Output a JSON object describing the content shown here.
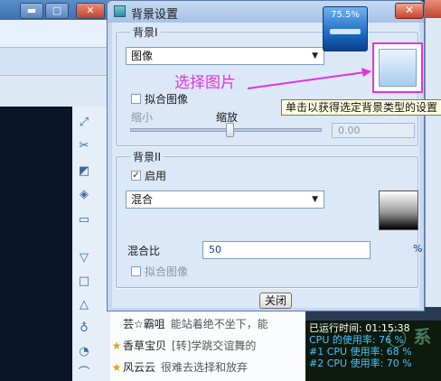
{
  "dialog": {
    "title": "背景设置",
    "close_glyph": "✕",
    "group1": {
      "title": "背景I",
      "type_select": "图像",
      "fit_image_label": "拟合图像",
      "scale_small_label": "缩小",
      "scale_label": "缩放",
      "scale_value": "0.00"
    },
    "group2": {
      "title": "背景II",
      "enable_label": "启用",
      "enable_checked": "✓",
      "type_select": "混合",
      "ratio_label": "混合比",
      "ratio_value": "50",
      "ratio_unit": "%",
      "fit_image_label": "拟合图像"
    },
    "close_button": "关闭"
  },
  "tooltip": "单击以获得选定背景类型的设置",
  "annotation": "选择图片",
  "meter": {
    "value": "75.5%",
    "level": 0.755
  },
  "background_window": {
    "buttons": [
      "▬",
      "▢",
      "✕"
    ]
  },
  "chat": [
    {
      "name": "芸☆霸咀",
      "message": "能站着绝不坐下，能"
    },
    {
      "name": "香草宝贝",
      "message": "[转]学跳交谊舞的"
    },
    {
      "name": "风云云",
      "message": "很难去选择和放弃"
    }
  ],
  "stats": {
    "uptime": "已运行时间: 01:15:38",
    "cpu": "CPU 的使用率: 76 %",
    "cpu1": "#1 CPU 使用率: 68 %",
    "cpu2": "#2 CPU 使用率: 70 %"
  },
  "icons": {
    "tools": [
      "resize-icon",
      "scissors-icon",
      "tag-icon",
      "shape-icon",
      "frame-icon",
      "filter-icon",
      "square-icon",
      "triangle-icon",
      "bell-icon",
      "dial-icon",
      "curve-icon"
    ]
  }
}
